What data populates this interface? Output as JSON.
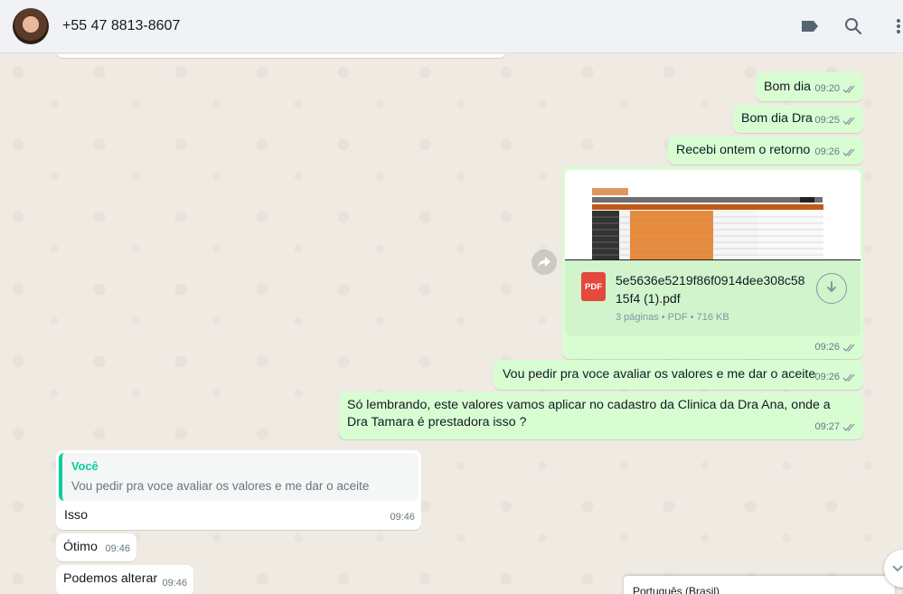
{
  "header": {
    "contact_name": "+55 47 8813-8607"
  },
  "messages": {
    "m1": {
      "text": "Bom dia",
      "time": "09:20"
    },
    "m2": {
      "text": "Bom dia Dra",
      "time": "09:25"
    },
    "m3": {
      "text": "Recebi ontem o retorno",
      "time": "09:26"
    },
    "doc": {
      "file_name": "5e5636e5219f86f0914dee308c5815f4 (1).pdf",
      "file_meta": "3 páginas • PDF • 716 KB",
      "icon_label": "PDF",
      "time": "09:26"
    },
    "m4": {
      "text": "Vou pedir pra voce avaliar os valores e me dar o aceite",
      "time": "09:26"
    },
    "m5": {
      "text": "Só lembrando, este valores vamos aplicar no cadastro da Clinica da Dra Ana, onde a Dra Tamara é prestadora isso ?",
      "time": "09:27"
    },
    "reply": {
      "quote_author": "Você",
      "quote_text": "Vou pedir pra voce avaliar os valores e me dar o aceite",
      "text": "Isso",
      "time": "09:46"
    },
    "m6": {
      "text": "Ótimo",
      "time": "09:46"
    },
    "m7": {
      "text": "Podemos alterar",
      "time": "09:46"
    }
  },
  "language_popup": {
    "label": "Português (Brasil)"
  },
  "colors": {
    "outgoing_bubble": "#d9fdd3",
    "incoming_bubble": "#ffffff",
    "quote_accent": "#06cf9c",
    "chat_background": "#efeae2"
  },
  "icons": {
    "label": "label-icon",
    "search": "search-icon",
    "menu": "menu-icon",
    "forward": "forward-icon",
    "download": "download-icon",
    "scroll_down": "chevron-down-icon",
    "read_receipt": "double-check-icon"
  }
}
